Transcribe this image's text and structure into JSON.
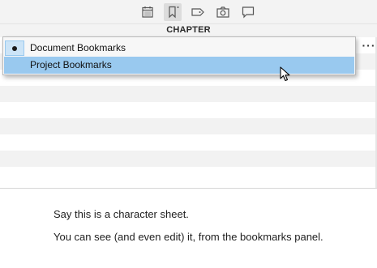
{
  "toolbar": {
    "icons": [
      "calendar-icon",
      "bookmark-icon",
      "tag-icon",
      "camera-icon",
      "comment-icon"
    ],
    "active_icon": "bookmark-icon"
  },
  "header": {
    "title": "CHAPTER",
    "more_label": "···"
  },
  "menu": {
    "items": [
      {
        "label": "Document Bookmarks",
        "checked": true,
        "highlighted": false
      },
      {
        "label": "Project Bookmarks",
        "checked": false,
        "highlighted": true
      }
    ]
  },
  "editor": {
    "lines": [
      "Say this is a character sheet.",
      "You can see (and even edit) it, from the bookmarks panel."
    ]
  },
  "colors": {
    "highlight": "#99c9ef",
    "check_bg": "#cce4f7",
    "toolbar_bg": "#f3f3f3",
    "stripe": "#f2f2f2"
  }
}
